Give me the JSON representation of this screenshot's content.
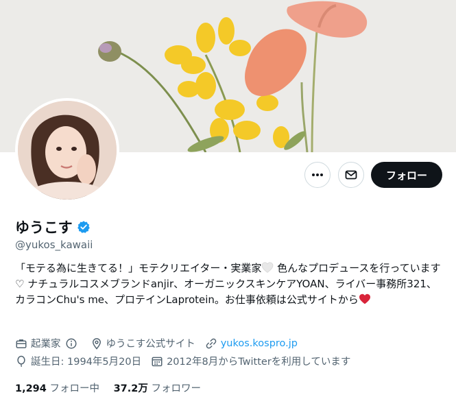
{
  "profile": {
    "name": "ゆうこす",
    "handle": "@yukos_kawaii",
    "bio_parts": [
      "「モテる為に生きてる！」モテクリエイター・実業家",
      " 色んなプロデュースを行っています♡ ナチュラルコスメブランドanjir、オーガニックスキンケアYOAN、ライバー事務所321、カラコンChu's me、プロテインLaprotein。お仕事依頼は公式サイトから"
    ],
    "category": "起業家",
    "location": "ゆうこす公式サイト",
    "website": "yukos.kospro.jp",
    "birthday": "誕生日: 1994年5月20日",
    "joined": "2012年8月からTwitterを利用しています",
    "following_count": "1,294",
    "following_label": " フォロー中",
    "followers_count": "37.2万",
    "followers_label": " フォロワー"
  },
  "actions": {
    "more_icon": "more-icon",
    "message_icon": "mail-icon",
    "follow_label": "フォロー"
  },
  "colors": {
    "accent": "#1d9bf0",
    "text": "#0f1419",
    "muted": "#536471",
    "follow_button_bg": "#0f1419",
    "heart": "#d8243a"
  }
}
